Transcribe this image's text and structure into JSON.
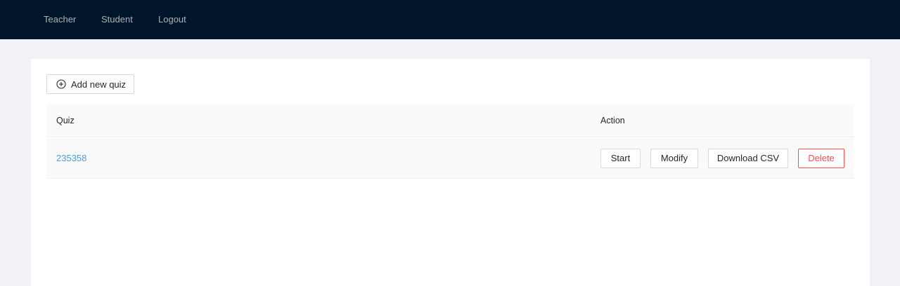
{
  "nav": {
    "items": [
      {
        "label": "Teacher"
      },
      {
        "label": "Student"
      },
      {
        "label": "Logout"
      }
    ]
  },
  "toolbar": {
    "add_label": "Add new quiz",
    "add_icon": "plus-circle-icon"
  },
  "table": {
    "columns": [
      "Quiz",
      "Action"
    ],
    "rows": [
      {
        "quiz": "235358",
        "actions": [
          "Start",
          "Modify",
          "Download CSV",
          "Delete"
        ]
      }
    ]
  },
  "colors": {
    "nav_bg": "#001529",
    "page_bg": "#f0f2f5",
    "link": "#4a9fd8",
    "danger": "#ff4d4f"
  }
}
